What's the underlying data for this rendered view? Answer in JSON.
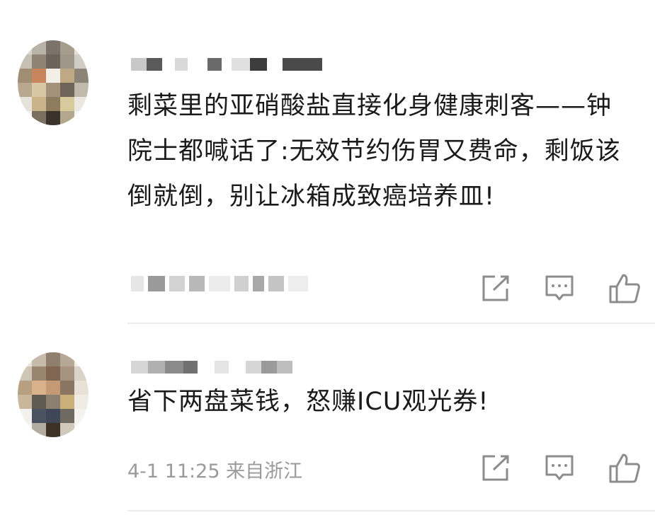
{
  "comments": [
    {
      "text": "剩菜里的亚硝酸盐直接化身健康刺客——钟院士都喊话了:无效节约伤胃又费命，剩饭该倒就倒，别让冰箱成致癌培养皿!"
    },
    {
      "text": "省下两盘菜钱，怒赚ICU观光券!",
      "meta": "4-1 11:25 来自浙江"
    }
  ],
  "icons": [
    "share-icon",
    "reply-icon",
    "like-icon"
  ],
  "colors": {
    "text": "#1a1a1a",
    "meta": "#9a9a9a",
    "icon": "#8c8c8c",
    "divider": "#ececec"
  }
}
